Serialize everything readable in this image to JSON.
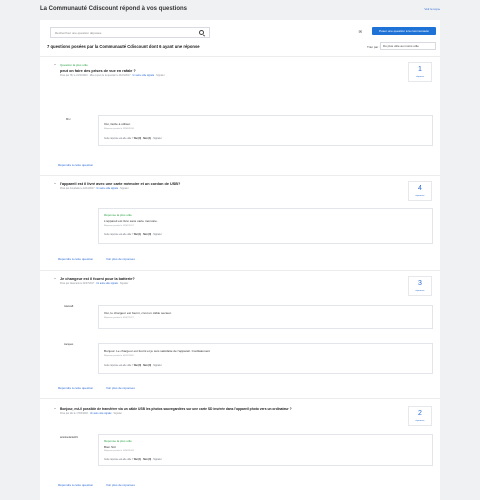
{
  "page": {
    "title": "La Communauté Cdiscount répond à vos questions",
    "top_link": "Voir le top ▸"
  },
  "search": {
    "placeholder": "Recherchez une question déposée"
  },
  "ask": {
    "icon": "chat-icon",
    "label": "Poser une question à la communauté"
  },
  "summary": "7 questions posées par la Communauté Cdiscount dont 6 ayant une réponse",
  "sort": {
    "label": "Trier par :",
    "value": "Du plus utile au moins utile"
  },
  "questions": [
    {
      "toggle": "−",
      "badge": "Question la plus utile",
      "title": "peut on faire des prises de vue en rafale ?",
      "meta_prefix": "Posé par Hli, le 21/10/2016 · Mise à jour de la question le 01/01/2017 ·",
      "meta_link": "Un autre utile signalé",
      "meta_suffix": "· Signaler",
      "count": "1",
      "count_label": "réponse",
      "answers": [
        {
          "author": "Mr.c",
          "best": "",
          "text": "Oui, facile à utiliser.",
          "date": "Réponse postée le 28/06/2018",
          "useful_prefix": "Cette réponse est-elle utile ?",
          "yes": "Oui (0)",
          "no": "Non (1)",
          "report": "Signaler"
        }
      ],
      "reply": "Répondre à cette question",
      "more": ""
    },
    {
      "toggle": "−",
      "badge": "",
      "title": "l'appareil est il livré avec une carte mémoire et un cordon de USB?",
      "meta_prefix": "Posé par Annabelle le 12/12/2017 ·",
      "meta_link": "Un autre utile signalé",
      "meta_suffix": "· Signaler",
      "count": "4",
      "count_label": "réponses",
      "answers": [
        {
          "author": "",
          "best": "Réponse la plus utile",
          "text": "L'appareil est livré sans carte mémoire.",
          "date": "Réponse postée le 18/01/2017",
          "useful_prefix": "Cette réponse est-elle utile ?",
          "yes": "Oui (1)",
          "no": "Non (0)",
          "report": "Signaler"
        }
      ],
      "reply": "Répondre à cette question",
      "more": "Voir plus de réponses"
    },
    {
      "toggle": "−",
      "badge": "",
      "title": "Je changeur est il fourni pour la batterie?",
      "meta_prefix": "Posé par Giancarlo le 04/07/2017 ·",
      "meta_link": "Un autre utile signalé",
      "meta_suffix": "· Signaler",
      "count": "3",
      "count_label": "réponses",
      "answers": [
        {
          "author": "Gianca8",
          "best": "",
          "text": "Oui, le chargeur est fourni, c'est un câble secteur.",
          "date": "Réponse postée le 05/07/2017",
          "useful_prefix": "Cette réponse est-elle utile ?",
          "yes": "Oui (0)",
          "no": "Non (0)",
          "report": "Signaler"
        },
        {
          "author": "Jacques",
          "best": "",
          "text": "Bonjour. Le chargeur est fourni et je suis satisfaite de l'appareil. Cordialement",
          "date": "Réponse postée le 06/11/2018",
          "useful_prefix": "Cette réponse est-elle utile ?",
          "yes": "Oui (0)",
          "no": "Non (0)",
          "report": "Signaler"
        }
      ],
      "reply": "Répondre à cette question",
      "more": "Voir plus de réponses"
    },
    {
      "toggle": "−",
      "badge": "",
      "title": "Bonjour, est-il possible de transférer via un câble USB les photos sauvegardées sur une carte SD insérée dans l'appareil photo vers un ordinateur ?",
      "meta_prefix": "Posé par loki le 17/03/2018 ·",
      "meta_link": "Un autre utile signalé",
      "meta_suffix": "· Signaler",
      "count": "2",
      "count_label": "réponses",
      "answers": [
        {
          "author": "antoinedantel19",
          "best": "Réponse la plus utile",
          "text": "Bien Sûr",
          "date": "Réponse postée le 18/03/2018",
          "useful_prefix": "Cette réponse est-elle utile ?",
          "yes": "Oui (1)",
          "no": "Non (0)",
          "report": "Signaler"
        }
      ],
      "reply": "Répondre à cette question",
      "more": "Voir plus de réponses"
    }
  ]
}
